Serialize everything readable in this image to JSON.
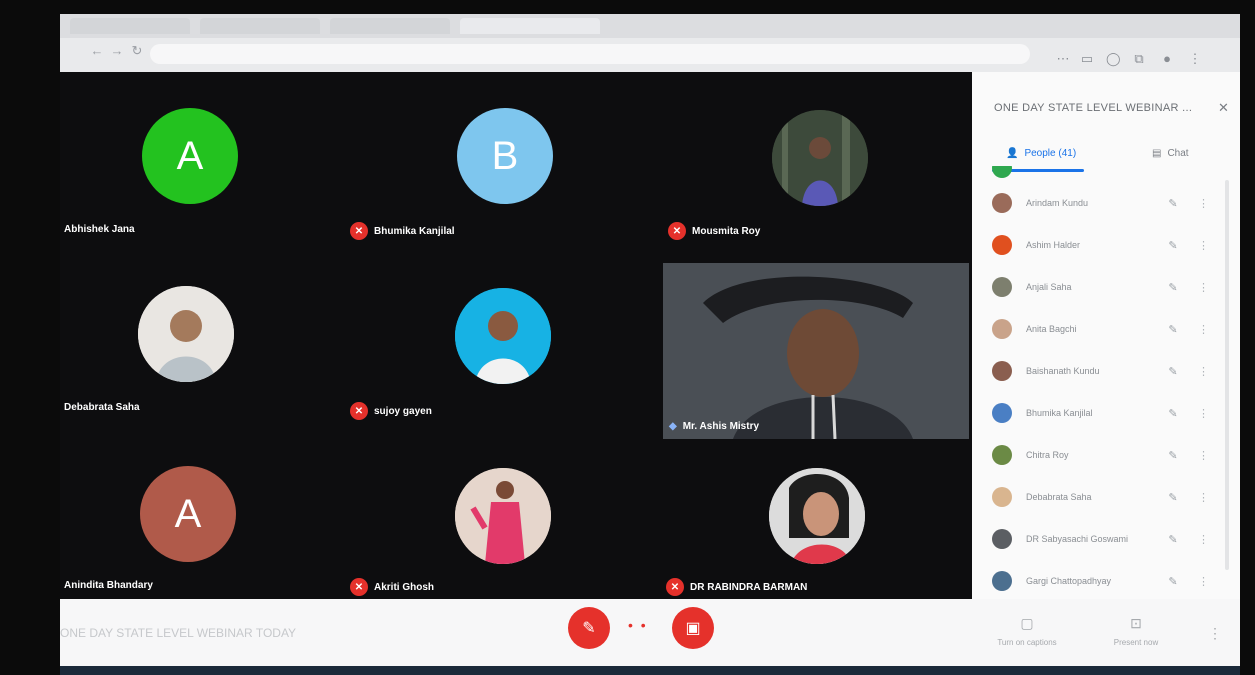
{
  "meeting": {
    "title": "ONE DAY STATE LEVEL WEBINAR ...",
    "bottom_label": "ONE DAY STATE LEVEL WEBINAR TODAY"
  },
  "tiles": [
    {
      "name": "Abhishek Jana",
      "muted": false,
      "avatar_letter": "A",
      "avatar_color": "#23c21f"
    },
    {
      "name": "Bhumika Kanjilal",
      "muted": true,
      "avatar_letter": "B",
      "avatar_color": "#7ec6ee"
    },
    {
      "name": "Mousmita Roy",
      "muted": true
    },
    {
      "name": "Debabrata Saha",
      "muted": false
    },
    {
      "name": "sujoy gayen",
      "muted": true
    },
    {
      "name": "Mr. Ashis Mistry",
      "muted": false
    },
    {
      "name": "Anindita Bhandary",
      "muted": false,
      "avatar_letter": "A",
      "avatar_color": "#b05a4a"
    },
    {
      "name": "Akriti Ghosh",
      "muted": true
    },
    {
      "name": "DR RABINDRA BARMAN",
      "muted": true
    }
  ],
  "panel": {
    "tab_people": "People (41)",
    "tab_chat": "Chat",
    "participants": [
      {
        "name": "Arindam Kundu",
        "color": "#9a6b5a"
      },
      {
        "name": "Ashim Halder",
        "color": "#e0501f"
      },
      {
        "name": "Anjali Saha",
        "color": "#7d7f6e"
      },
      {
        "name": "Anita Bagchi",
        "color": "#c9a38a"
      },
      {
        "name": "Baishanath Kundu",
        "color": "#8a5e4f"
      },
      {
        "name": "Bhumika Kanjilal",
        "color": "#4a7fc4"
      },
      {
        "name": "Chitra Roy",
        "color": "#6b8a45"
      },
      {
        "name": "Debabrata Saha",
        "color": "#d9b58f"
      },
      {
        "name": "DR Sabyasachi Goswami",
        "color": "#5b5e63"
      },
      {
        "name": "Gargi Chattopadhyay",
        "color": "#4c6f8f"
      }
    ]
  },
  "bottombar": {
    "captions_label": "Turn on captions",
    "present_label": "Present now"
  },
  "colors": {
    "accent": "#1a73e8",
    "danger": "#e5312b",
    "stage_bg": "#0d0d0f"
  },
  "icons": {
    "mic_off": "mic-off-icon",
    "camera_off": "camera-off-icon",
    "people": "people-icon",
    "chat": "chat-icon",
    "more": "more-vert-icon"
  }
}
